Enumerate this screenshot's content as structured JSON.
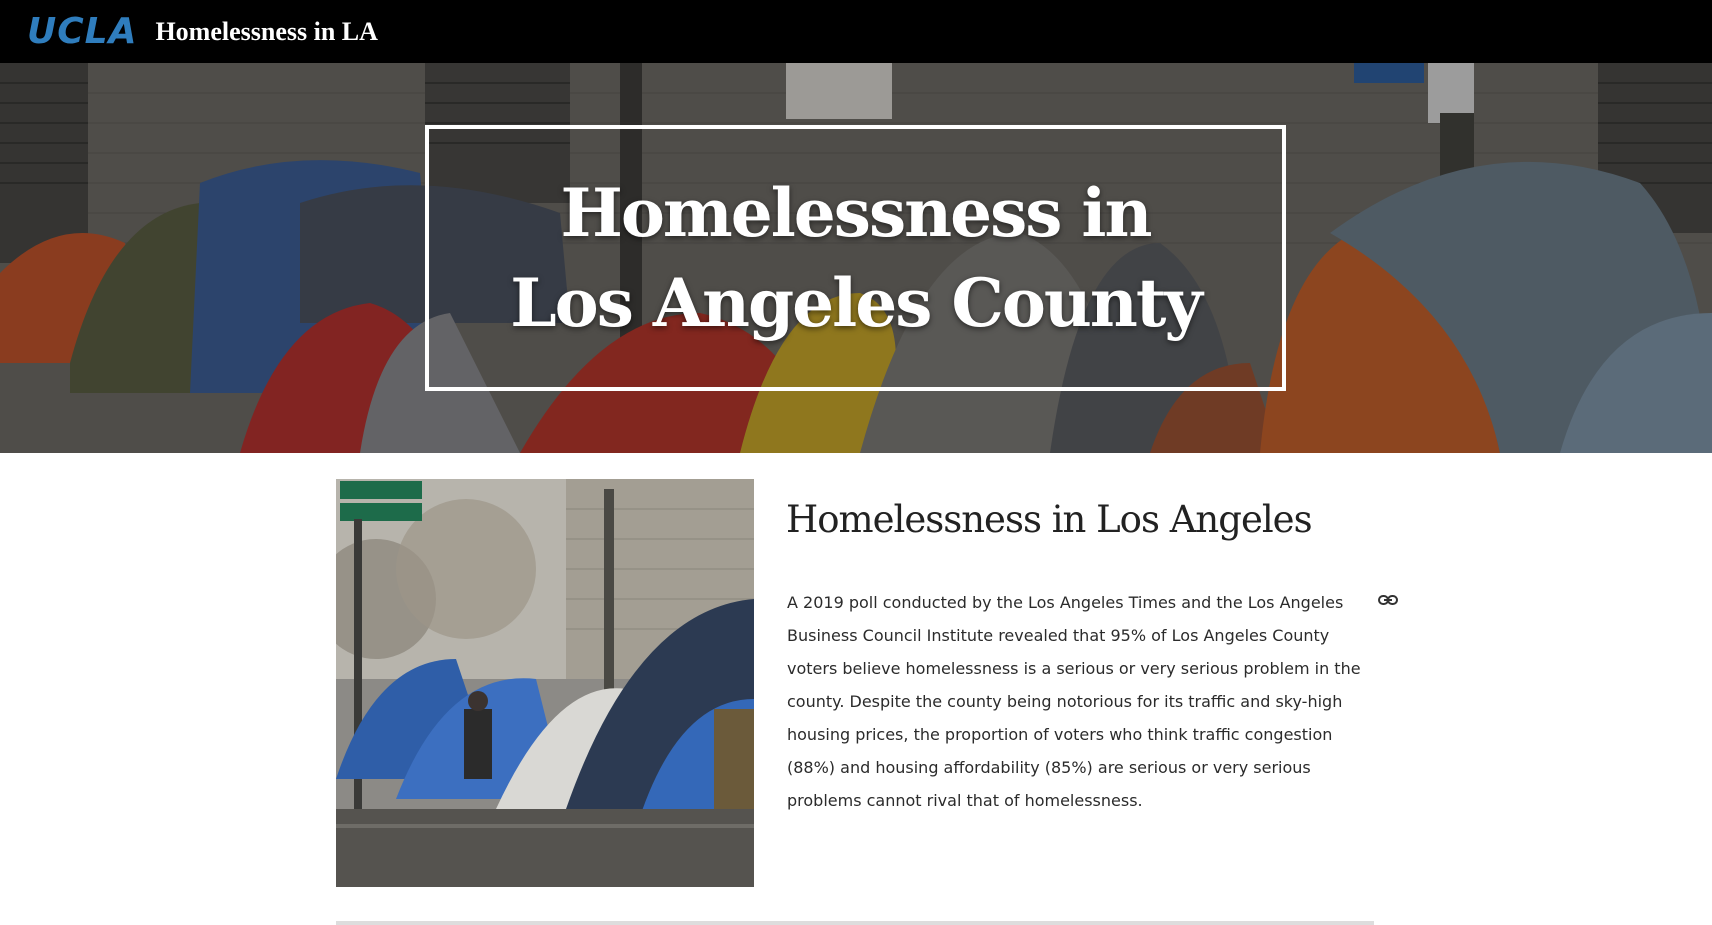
{
  "header": {
    "logo_text": "UCLA",
    "site_title": "Homelessness in LA"
  },
  "hero": {
    "title": "Homelessness in Los Angeles County",
    "background_image": "homeless-encampment-tents-photo"
  },
  "main": {
    "image": "street-tents-photo",
    "heading": "Homelessness in Los Angeles",
    "paragraph": "A 2019 poll conducted by the Los Angeles Times and the Los Angeles Business Council Institute revealed that 95% of Los Angeles County voters believe homelessness is a serious or very serious problem in the county. Despite the county being notorious for its traffic and sky-high housing prices, the proportion of voters who think traffic congestion (88%) and housing affordability (85%) are serious or very serious problems cannot rival that of homelessness.",
    "link_icon": "link-icon"
  },
  "colors": {
    "topbar_bg": "#000000",
    "logo": "#2f7dbd",
    "text": "#2b2b2b"
  }
}
